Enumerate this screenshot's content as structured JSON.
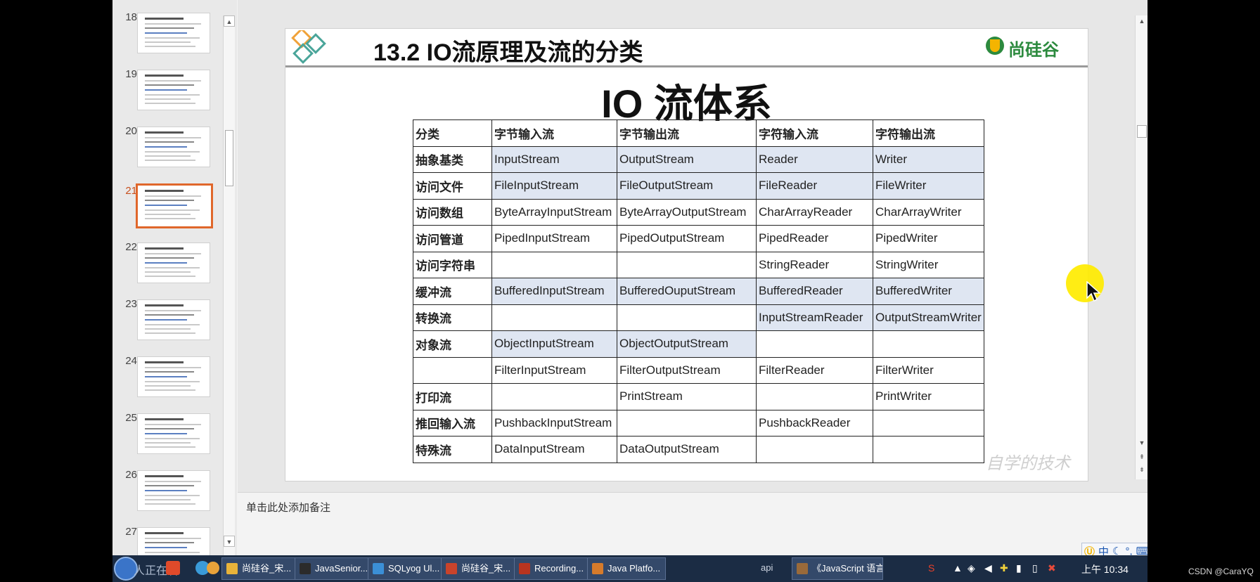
{
  "thumbnails": [
    {
      "number": "18",
      "active": false
    },
    {
      "number": "19",
      "active": false
    },
    {
      "number": "20",
      "active": false
    },
    {
      "number": "21",
      "active": true
    },
    {
      "number": "22",
      "active": false
    },
    {
      "number": "23",
      "active": false
    },
    {
      "number": "24",
      "active": false
    },
    {
      "number": "25",
      "active": false
    },
    {
      "number": "26",
      "active": false
    },
    {
      "number": "27",
      "active": false
    }
  ],
  "slide": {
    "title": "13.2 IO流原理及流的分类",
    "brand": "尚硅谷",
    "heading": "IO 流体系",
    "watermark": "自学的技术",
    "table": {
      "headers": [
        "分类",
        "字节输入流",
        "字节输出流",
        "字符输入流",
        "字符输出流"
      ],
      "rows": [
        [
          "抽象基类",
          "InputStream",
          "OutputStream",
          "Reader",
          "Writer"
        ],
        [
          "访问文件",
          "FileInputStream",
          "FileOutputStream",
          "FileReader",
          "FileWriter"
        ],
        [
          "访问数组",
          "ByteArrayInputStream",
          "ByteArrayOutputStream",
          "CharArrayReader",
          "CharArrayWriter"
        ],
        [
          "访问管道",
          "PipedInputStream",
          "PipedOutputStream",
          "PipedReader",
          "PipedWriter"
        ],
        [
          "访问字符串",
          "",
          "",
          "StringReader",
          "StringWriter"
        ],
        [
          "缓冲流",
          "BufferedInputStream",
          "BufferedOuputStream",
          "BufferedReader",
          "BufferedWriter"
        ],
        [
          "转换流",
          "",
          "",
          "InputStreamReader",
          "OutputStreamWriter"
        ],
        [
          "对象流",
          "ObjectInputStream",
          "ObjectOutputStream",
          "",
          ""
        ],
        [
          "",
          "FilterInputStream",
          "FilterOutputStream",
          "FilterReader",
          "FilterWriter"
        ],
        [
          "打印流",
          "",
          "PrintStream",
          "",
          "PrintWriter"
        ],
        [
          "推回输入流",
          "PushbackInputStream",
          "",
          "PushbackReader",
          ""
        ],
        [
          "特殊流",
          "DataInputStream",
          "DataOutputStream",
          "",
          ""
        ]
      ],
      "highlighted_cells": [
        [
          0,
          1
        ],
        [
          0,
          2
        ],
        [
          0,
          3
        ],
        [
          0,
          4
        ],
        [
          1,
          1
        ],
        [
          1,
          2
        ],
        [
          1,
          3
        ],
        [
          1,
          4
        ],
        [
          5,
          1
        ],
        [
          5,
          2
        ],
        [
          5,
          3
        ],
        [
          5,
          4
        ],
        [
          6,
          3
        ],
        [
          6,
          4
        ],
        [
          7,
          1
        ],
        [
          7,
          2
        ]
      ],
      "highlight_color": "#dfe6f2"
    }
  },
  "notes": {
    "placeholder": "单击此处添加备注"
  },
  "ime": {
    "label": "中"
  },
  "taskbar": {
    "overlay_text": "人正在看",
    "tasks": [
      {
        "label": "尚硅谷_宋...",
        "icon_color": "#e8b33a"
      },
      {
        "label": "JavaSenior...",
        "icon_color": "#2b2b2b"
      },
      {
        "label": "SQLyog Ul...",
        "icon_color": "#3b8fd6"
      },
      {
        "label": "尚硅谷_宋...",
        "icon_color": "#c9432b"
      },
      {
        "label": "Recording...",
        "icon_color": "#b8341f"
      },
      {
        "label": "Java Platfo...",
        "icon_color": "#d67b2b"
      }
    ],
    "tail_tasks": [
      {
        "label": "api"
      },
      {
        "label": "《JavaScript 语言参考..."
      }
    ],
    "clock": "上午 10:34"
  },
  "watermark_corner": "CSDN @CaraYQ",
  "colors": {
    "accent_active_thumb": "#e0672b",
    "brand_green": "#2c8a3e",
    "cursor_highlight": "#ffeb00"
  }
}
